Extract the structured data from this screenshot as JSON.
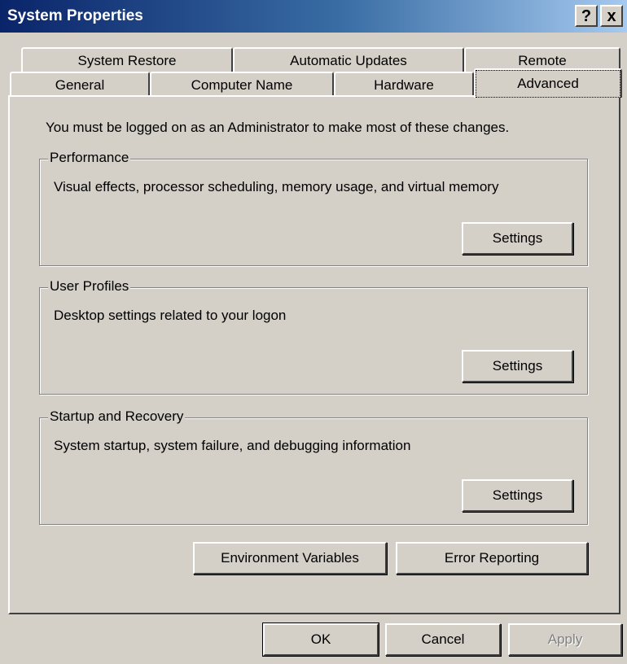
{
  "window": {
    "title": "System Properties",
    "help_label": "?",
    "close_label": "x"
  },
  "tabs": {
    "back_row": [
      {
        "label": "System Restore"
      },
      {
        "label": "Automatic Updates"
      },
      {
        "label": "Remote"
      }
    ],
    "front_row": [
      {
        "label": "General"
      },
      {
        "label": "Computer Name"
      },
      {
        "label": "Hardware"
      },
      {
        "label": "Advanced"
      }
    ],
    "selected": "Advanced"
  },
  "advanced": {
    "admin_note": "You must be logged on as an Administrator to make most of these changes.",
    "groups": [
      {
        "legend": "Performance",
        "description": "Visual effects, processor scheduling, memory usage, and virtual memory",
        "button_label": "Settings"
      },
      {
        "legend": "User Profiles",
        "description": "Desktop settings related to your logon",
        "button_label": "Settings"
      },
      {
        "legend": "Startup and Recovery",
        "description": "System startup, system failure, and debugging information",
        "button_label": "Settings"
      }
    ],
    "environment_variables_label": "Environment Variables",
    "error_reporting_label": "Error Reporting"
  },
  "footer": {
    "ok_label": "OK",
    "cancel_label": "Cancel",
    "apply_label": "Apply",
    "apply_enabled": false
  }
}
